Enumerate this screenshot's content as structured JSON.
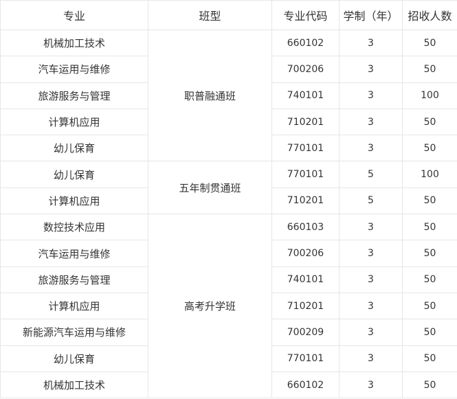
{
  "table": {
    "headers": [
      "专业",
      "班型",
      "专业代码",
      "学制（年）",
      "招收人数"
    ],
    "groups": [
      {
        "class_type": "职普融通班",
        "rows": [
          {
            "major": "机械加工技术",
            "code": "660102",
            "years": "3",
            "count": "50"
          },
          {
            "major": "汽车运用与维修",
            "code": "700206",
            "years": "3",
            "count": "50"
          },
          {
            "major": "旅游服务与管理",
            "code": "740101",
            "years": "3",
            "count": "100"
          },
          {
            "major": "计算机应用",
            "code": "710201",
            "years": "3",
            "count": "50"
          },
          {
            "major": "幼儿保育",
            "code": "770101",
            "years": "3",
            "count": "50"
          }
        ]
      },
      {
        "class_type": "五年制贯通班",
        "rows": [
          {
            "major": "幼儿保育",
            "code": "770101",
            "years": "5",
            "count": "100"
          },
          {
            "major": "计算机应用",
            "code": "710201",
            "years": "5",
            "count": "50"
          }
        ]
      },
      {
        "class_type": "高考升学班",
        "rows": [
          {
            "major": "数控技术应用",
            "code": "660103",
            "years": "3",
            "count": "50"
          },
          {
            "major": "汽车运用与维修",
            "code": "700206",
            "years": "3",
            "count": "50"
          },
          {
            "major": "旅游服务与管理",
            "code": "740101",
            "years": "3",
            "count": "50"
          },
          {
            "major": "计算机应用",
            "code": "710201",
            "years": "3",
            "count": "50"
          },
          {
            "major": "新能源汽车运用与维修",
            "code": "700209",
            "years": "3",
            "count": "50"
          },
          {
            "major": "幼儿保育",
            "code": "770101",
            "years": "3",
            "count": "50"
          },
          {
            "major": "机械加工技术",
            "code": "660102",
            "years": "3",
            "count": "50"
          }
        ]
      }
    ]
  }
}
